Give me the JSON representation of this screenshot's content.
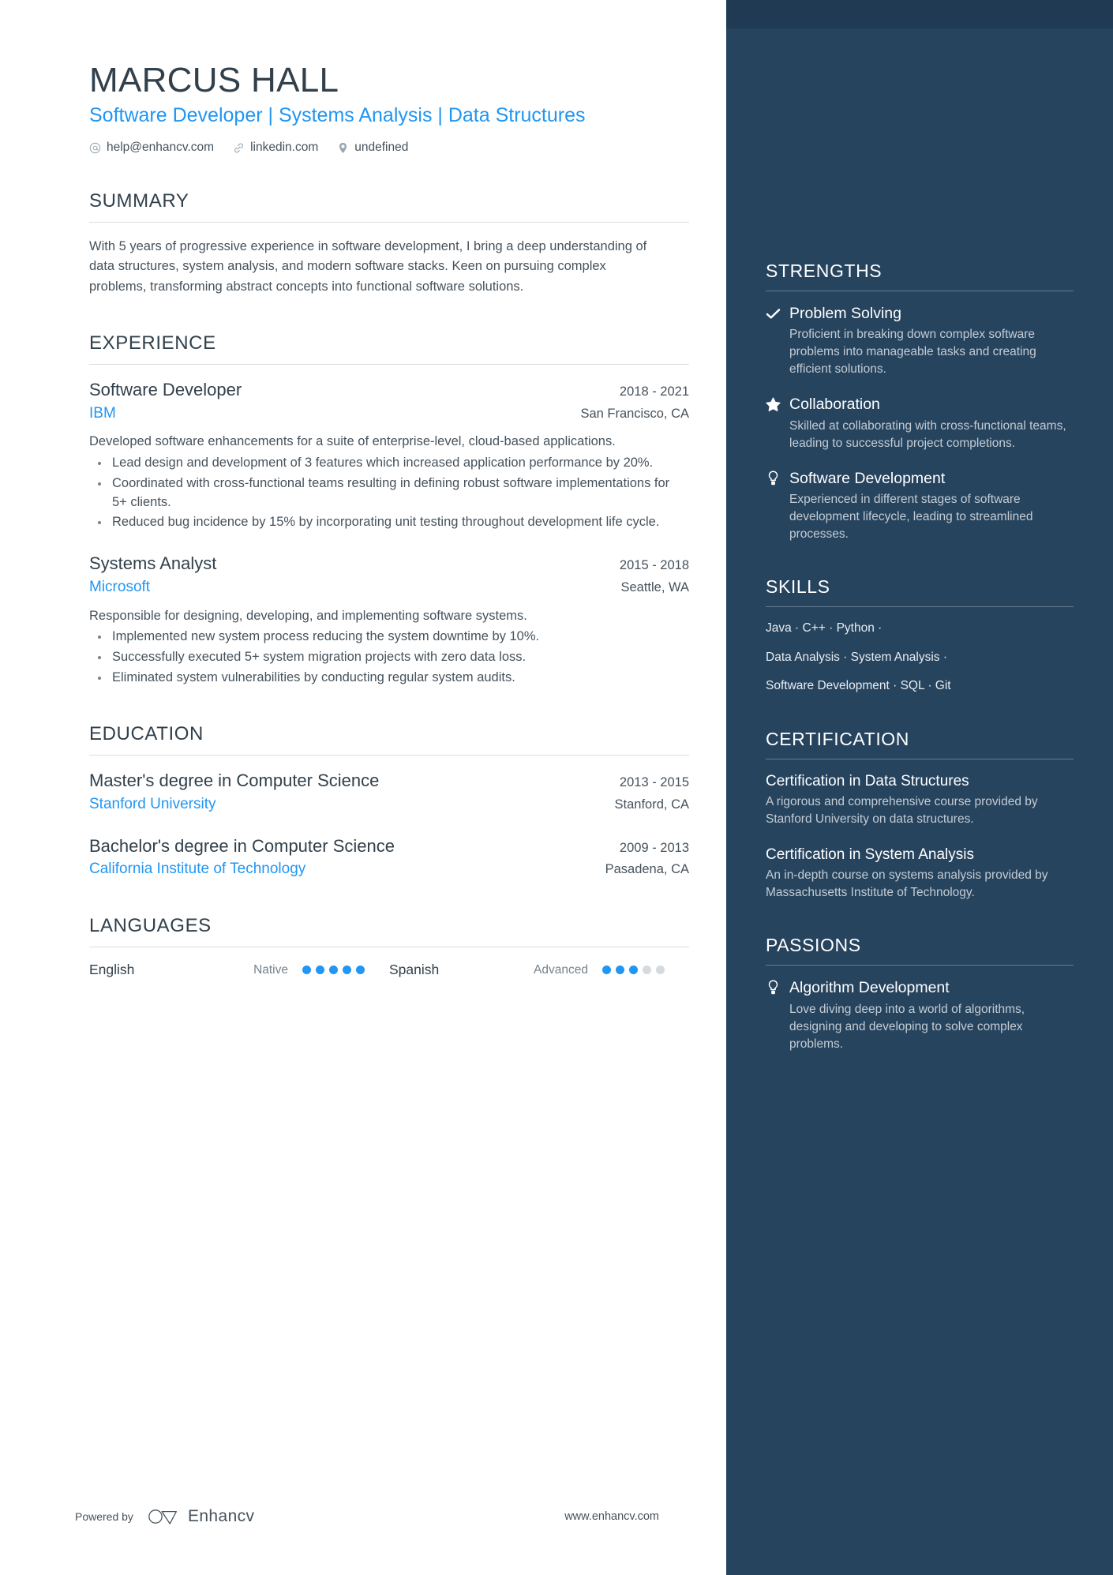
{
  "header": {
    "name": "MARCUS HALL",
    "headline": "Software Developer | Systems Analysis | Data Structures",
    "contacts": [
      {
        "icon": "at-icon",
        "text": "help@enhancv.com"
      },
      {
        "icon": "link-icon",
        "text": "linkedin.com"
      },
      {
        "icon": "location-pin-icon",
        "text": "undefined"
      }
    ]
  },
  "summary": {
    "title": "SUMMARY",
    "text": "With 5 years of progressive experience in software development, I bring a deep understanding of data structures, system analysis, and modern software stacks. Keen on pursuing complex problems, transforming abstract concepts into functional software solutions."
  },
  "experience": {
    "title": "EXPERIENCE",
    "entries": [
      {
        "role": "Software Developer",
        "date": "2018 - 2021",
        "company": "IBM",
        "location": "San Francisco, CA",
        "description": "Developed software enhancements for a suite of enterprise-level, cloud-based applications.",
        "bullets": [
          "Lead design and development of 3 features which increased application performance by 20%.",
          "Coordinated with cross-functional teams resulting in defining robust software implementations for 5+ clients.",
          "Reduced bug incidence by 15% by incorporating unit testing throughout development life cycle."
        ]
      },
      {
        "role": "Systems Analyst",
        "date": "2015 - 2018",
        "company": "Microsoft",
        "location": "Seattle, WA",
        "description": "Responsible for designing, developing, and implementing software systems.",
        "bullets": [
          "Implemented new system process reducing the system downtime by 10%.",
          "Successfully executed 5+ system migration projects with zero data loss.",
          "Eliminated system vulnerabilities by conducting regular system audits."
        ]
      }
    ]
  },
  "education": {
    "title": "EDUCATION",
    "entries": [
      {
        "degree": "Master's degree in Computer Science",
        "date": "2013 - 2015",
        "school": "Stanford University",
        "location": "Stanford, CA"
      },
      {
        "degree": "Bachelor's degree in Computer Science",
        "date": "2009 - 2013",
        "school": "California Institute of Technology",
        "location": "Pasadena, CA"
      }
    ]
  },
  "languages": {
    "title": "LANGUAGES",
    "items": [
      {
        "name": "English",
        "level": "Native",
        "filled": 5,
        "total": 5
      },
      {
        "name": "Spanish",
        "level": "Advanced",
        "filled": 3,
        "total": 5
      }
    ]
  },
  "strengths": {
    "title": "STRENGTHS",
    "items": [
      {
        "icon": "check-icon",
        "name": "Problem Solving",
        "description": "Proficient in breaking down complex software problems into manageable tasks and creating efficient solutions."
      },
      {
        "icon": "star-half-icon",
        "name": "Collaboration",
        "description": "Skilled at collaborating with cross-functional teams, leading to successful project completions."
      },
      {
        "icon": "lightbulb-icon",
        "name": "Software Development",
        "description": "Experienced in different stages of software development lifecycle, leading to streamlined processes."
      }
    ]
  },
  "skills": {
    "title": "SKILLS",
    "lines": [
      "Java · C++ · Python ·",
      "Data Analysis · System Analysis ·",
      "Software Development · SQL · Git"
    ],
    "list": [
      "Java",
      "C++",
      "Python",
      "Data Analysis",
      "System Analysis",
      "Software Development",
      "SQL",
      "Git"
    ]
  },
  "certification": {
    "title": "CERTIFICATION",
    "items": [
      {
        "name": "Certification in Data Structures",
        "description": "A rigorous and comprehensive course provided by Stanford University on data structures."
      },
      {
        "name": "Certification in System Analysis",
        "description": "An in-depth course on systems analysis provided by Massachusetts Institute of Technology."
      }
    ]
  },
  "passions": {
    "title": "PASSIONS",
    "items": [
      {
        "icon": "lightbulb-icon",
        "name": "Algorithm Development",
        "description": "Love diving deep into a world of algorithms, designing and developing to solve complex problems."
      }
    ]
  },
  "footer": {
    "powered_by": "Powered by",
    "brand": "Enhancv",
    "url": "www.enhancv.com"
  },
  "colors": {
    "accent_blue": "#2196f3",
    "sidebar_bg": "#27445e",
    "sidebar_top": "#1f3a52",
    "heading": "#31404b",
    "body_text": "#46525c"
  }
}
